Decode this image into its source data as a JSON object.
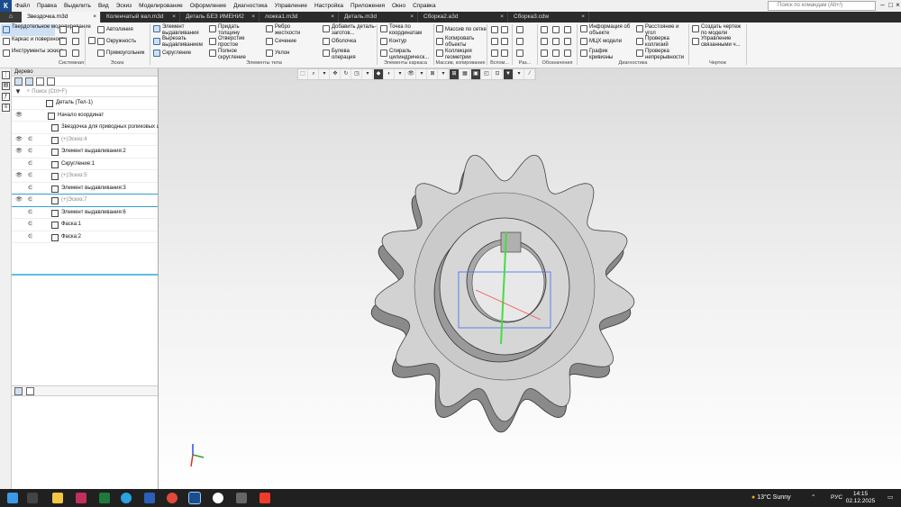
{
  "menu": {
    "items": [
      "Файл",
      "Правка",
      "Выделить",
      "Вид",
      "Эскиз",
      "Моделирование",
      "Оформление",
      "Диагностика",
      "Управление",
      "Настройка",
      "Приложения",
      "Окно",
      "Справка"
    ],
    "search_placeholder": "Поиск по командам (Alt+/)"
  },
  "tabs": [
    {
      "label": "Звездочка.m3d",
      "active": true
    },
    {
      "label": "Коленчатый вал.m3d"
    },
    {
      "label": "Деталь БЕЗ ИМЕНИ2"
    },
    {
      "label": "ложка1.m3d"
    },
    {
      "label": "Деталь.m3d"
    },
    {
      "label": "Сборка2.a3d"
    },
    {
      "label": "Сборка3.cdw"
    }
  ],
  "ribbon": {
    "modes": [
      "Твердотельное моделирование",
      "Каркас и поверхности",
      "Инструменты эскиза"
    ],
    "sketch": [
      "Автолиния",
      "Окружность",
      "Прямоугольник"
    ],
    "body1": [
      "Элемент выдавливания",
      "Вырезать выдавливанием",
      "Скругление"
    ],
    "body2": [
      "Придать толщину",
      "Отверстие простое",
      "Полное скругление"
    ],
    "body3": [
      "Ребро жесткости",
      "Сечение",
      "Уклон"
    ],
    "body4": [
      "Добавить деталь-заготов...",
      "Оболочка",
      "Булева операция"
    ],
    "wire": [
      "Точка по координатам",
      "Контур",
      "Спираль цилиндрическ..."
    ],
    "array": [
      "Массив по сетке",
      "Копировать объекты",
      "Коллекция геометрии"
    ],
    "diag1": [
      "Информация об объекте",
      "МЦХ модели",
      "График кривизны"
    ],
    "diag2": [
      "Расстояние и угол",
      "Проверка коллизий",
      "Проверка непрерывности"
    ],
    "draw": [
      "Создать чертеж по модели",
      "Управление связанными ч..."
    ],
    "groups": [
      "Системная",
      "Эскиз",
      "Элементы тела",
      "Элементы каркаса",
      "Массив, копирование",
      "Вспом...",
      "Раз...",
      "Обозначения",
      "Диагностика",
      "Чертеж"
    ]
  },
  "tree": {
    "title": "Дерево",
    "search_placeholder": "Поиск (Ctrl+F)",
    "rows": [
      {
        "label": "Деталь (Тел-1)",
        "eye": "",
        "e": ""
      },
      {
        "label": "Начало координат",
        "eye": "👁",
        "e": ""
      },
      {
        "label": "Звездочка для приводных роликовых цепей",
        "eye": "",
        "e": ""
      },
      {
        "label": "(+)Эскиз:4",
        "eye": "👁",
        "e": "∈",
        "dim": true
      },
      {
        "label": "Элемент выдавливания:2",
        "eye": "👁",
        "e": "∈"
      },
      {
        "label": "Скругление:1",
        "eye": "",
        "e": "∈"
      },
      {
        "label": "(+)Эскиз:5",
        "eye": "👁",
        "e": "∈",
        "dim": true
      },
      {
        "label": "Элемент выдавливания:3",
        "eye": "",
        "e": "∈"
      },
      {
        "label": "(+)Эскиз:7",
        "eye": "👁",
        "e": "∈",
        "dim": true
      },
      {
        "label": "Элемент выдавливания:6",
        "eye": "",
        "e": "∈"
      },
      {
        "label": "Фаска:1",
        "eye": "",
        "e": "∈"
      },
      {
        "label": "Фаска:2",
        "eye": "",
        "e": "∈"
      }
    ]
  },
  "taskbar": {
    "weather": "13°C  Sunny",
    "lang": "РУС",
    "time": "14:15",
    "date": "02.12.2025"
  }
}
